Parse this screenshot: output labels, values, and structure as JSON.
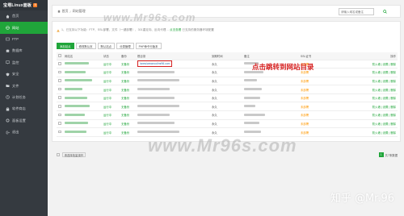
{
  "sidebar": {
    "brand": "宝塔Linux面板",
    "badge": "5",
    "items": [
      {
        "label": "首页",
        "icon": "home-icon"
      },
      {
        "label": "网站",
        "icon": "globe-icon",
        "active": true
      },
      {
        "label": "FTP",
        "icon": "ftp-icon"
      },
      {
        "label": "数据库",
        "icon": "database-icon"
      },
      {
        "label": "监控",
        "icon": "monitor-icon"
      },
      {
        "label": "安全",
        "icon": "shield-icon"
      },
      {
        "label": "文件",
        "icon": "folder-icon"
      },
      {
        "label": "计划任务",
        "icon": "clock-icon"
      },
      {
        "label": "软件商店",
        "icon": "store-icon"
      },
      {
        "label": "面板设置",
        "icon": "gear-icon"
      },
      {
        "label": "退出",
        "icon": "logout-icon"
      }
    ]
  },
  "breadcrumb": {
    "home": "首页",
    "separator": "/",
    "current": "网站管理"
  },
  "search": {
    "placeholder": "请输入域名或备注"
  },
  "notice": {
    "text": "1、已支持以下功能：FTP、SSL部署、文件（一键部署）、301重定向、反向代理…",
    "link": "点击查看",
    "tail": "已支持的服务器环境配置"
  },
  "toolbar": {
    "add_site": "添加站点",
    "default_page": "修改默认页",
    "default_site": "默认站点",
    "category": "分类管理",
    "php_cli": "PHP命令行版本"
  },
  "table": {
    "headers": [
      "网站名",
      "状态",
      "备份",
      "根目录",
      "到期时间",
      "备注",
      "SSL证书",
      "操作"
    ],
    "rows": [
      {
        "status": "运行中",
        "backup": "无备份",
        "root": "/www/wwwroot/mr96.com",
        "expire": "永久",
        "ssl": "未部署",
        "ops": "防火墙 | 设置 | 删除"
      },
      {
        "status": "运行中",
        "backup": "无备份",
        "root": "",
        "expire": "永久",
        "ssl": "未部署",
        "ops": "防火墙 | 设置 | 删除"
      },
      {
        "status": "运行中",
        "backup": "无备份",
        "root": "",
        "expire": "永久",
        "ssl": "未部署",
        "ops": "防火墙 | 设置 | 删除"
      },
      {
        "status": "运行中",
        "backup": "无备份",
        "root": "",
        "expire": "永久",
        "ssl": "未部署",
        "ops": "防火墙 | 设置 | 删除"
      },
      {
        "status": "运行中",
        "backup": "无备份",
        "root": "",
        "expire": "永久",
        "ssl": "未部署",
        "ops": "防火墙 | 设置 | 删除"
      },
      {
        "status": "运行中",
        "backup": "无备份",
        "root": "",
        "expire": "永久",
        "ssl": "未部署",
        "ops": "防火墙 | 设置 | 删除"
      },
      {
        "status": "运行中",
        "backup": "无备份",
        "root": "",
        "expire": "永久",
        "ssl": "未部署",
        "ops": "防火墙 | 设置 | 删除"
      },
      {
        "status": "运行中",
        "backup": "无备份",
        "root": "",
        "expire": "永久",
        "ssl": "未部署",
        "ops": "防火墙 | 设置 | 删除"
      },
      {
        "status": "运行中",
        "backup": "无备份",
        "root": "",
        "expire": "永久",
        "ssl": "未部署",
        "ops": "防火墙 | 设置 | 删除"
      }
    ]
  },
  "callout": "点击跳转到网站目录",
  "pager": {
    "batch": "请选择批量操作",
    "page": "1",
    "total": "共7条数据"
  },
  "watermarks": {
    "top": "www.Mr96s.com",
    "bottom": "www.Mr96s.com"
  },
  "attribution": "知乎 @Mr.96",
  "colors": {
    "accent": "#20a53a",
    "sidebar": "#353a40",
    "annotation": "#d62020"
  }
}
